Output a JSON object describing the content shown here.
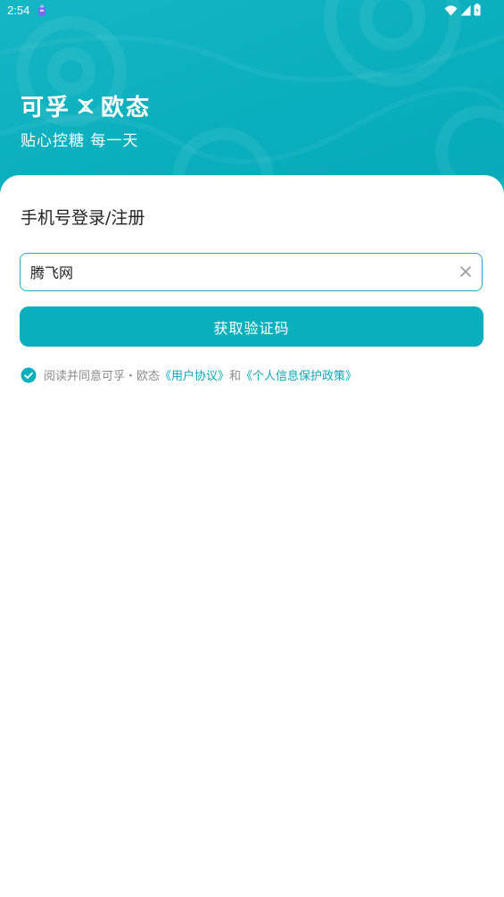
{
  "status_bar": {
    "time": "2:54",
    "app_icon": "notification-app-icon",
    "icons": [
      "wifi-icon",
      "signal-icon",
      "battery-icon"
    ]
  },
  "hero": {
    "brand_left": "可孚",
    "brand_separator_icon": "cross-x-icon",
    "brand_right": "欧态",
    "slogan": "贴心控糖 每一天"
  },
  "login": {
    "title": "手机号登录/注册",
    "phone_value": "腾飞网",
    "clear_icon": "close-icon",
    "code_button_label": "获取验证码",
    "agreement": {
      "prefix": "阅读并同意可孚・欧态",
      "user_agreement": "《用户协议》",
      "conjunction": "和",
      "privacy_policy": "《个人信息保护政策》",
      "checked": true
    }
  },
  "colors": {
    "accent": "#0aafbe",
    "link": "#0aa7b6",
    "muted_text": "#8a8a8a",
    "title_text": "#222222"
  }
}
